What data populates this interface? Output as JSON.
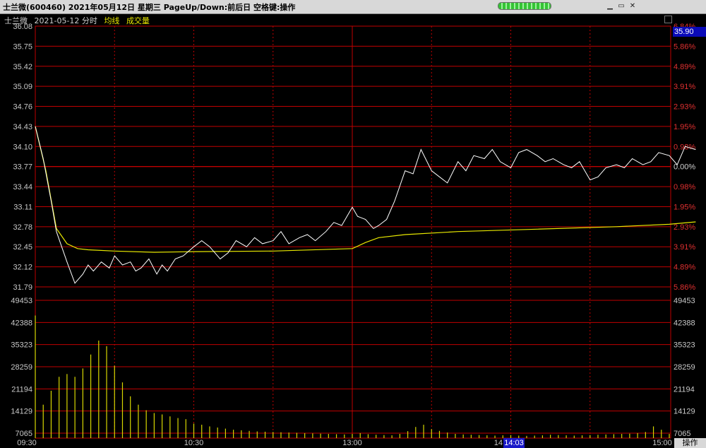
{
  "window": {
    "title": "士兰微(600460)  2021年05月12日 星期三  PageUp/Down:前后日  空格键:操作"
  },
  "header": {
    "name": "士兰微",
    "date": "2021-05-12 分时",
    "legend_avg": "均线",
    "legend_vol": "成交量"
  },
  "price_box": "35.90",
  "corner_button": "操作",
  "cursor_time": "14:03",
  "colors": {
    "grid": "#c00000",
    "price_line": "#ffffff",
    "avg_line": "#e8e800",
    "volume": "#d8d800",
    "axis_text_left": "#c8c8c8",
    "axis_text_right": "#e03030"
  },
  "chart_data": {
    "type": "line",
    "price_ticks": [
      "36.08",
      "35.75",
      "35.42",
      "35.09",
      "34.76",
      "34.43",
      "34.10",
      "33.77",
      "33.44",
      "33.11",
      "32.78",
      "32.45",
      "32.12",
      "31.79"
    ],
    "pct_ticks": [
      "6.84%",
      "5.86%",
      "4.89%",
      "3.91%",
      "2.93%",
      "1.95%",
      "0.98%",
      "0.00%",
      "0.98%",
      "1.95%",
      "2.93%",
      "3.91%",
      "4.89%",
      "5.86%"
    ],
    "ylim_price": [
      31.79,
      36.08
    ],
    "volume_ticks": [
      "49453",
      "42388",
      "35323",
      "28259",
      "21194",
      "14129",
      "7065"
    ],
    "ylim_volume": [
      0,
      49453
    ],
    "x_ticks": [
      "09:30",
      "10:30",
      "13:00",
      "14",
      "15:00"
    ],
    "price_series": {
      "minutes": [
        0,
        3,
        6,
        8,
        12,
        15,
        18,
        20,
        22,
        25,
        28,
        30,
        33,
        36,
        38,
        40,
        43,
        46,
        48,
        50,
        53,
        56,
        60,
        63,
        66,
        70,
        73,
        76,
        80,
        83,
        86,
        90,
        93,
        96,
        100,
        103,
        106,
        110,
        113,
        116,
        120,
        122,
        125,
        128,
        130,
        133,
        136,
        140,
        143,
        146,
        150,
        153,
        156,
        160,
        163,
        166,
        170,
        173,
        176,
        180,
        183,
        186,
        190,
        193,
        196,
        200,
        203,
        206,
        210,
        213,
        216,
        220,
        223,
        226,
        230,
        233,
        236,
        240,
        243,
        246,
        250
      ],
      "prices": [
        34.43,
        33.9,
        33.2,
        32.7,
        32.2,
        31.85,
        32.0,
        32.15,
        32.05,
        32.2,
        32.1,
        32.3,
        32.15,
        32.2,
        32.05,
        32.1,
        32.25,
        32.0,
        32.15,
        32.05,
        32.25,
        32.3,
        32.45,
        32.55,
        32.45,
        32.25,
        32.35,
        32.55,
        32.45,
        32.6,
        32.5,
        32.55,
        32.7,
        32.5,
        32.6,
        32.65,
        32.55,
        32.7,
        32.85,
        32.8,
        33.1,
        32.95,
        32.9,
        32.75,
        32.8,
        32.9,
        33.2,
        33.7,
        33.65,
        34.05,
        33.7,
        33.6,
        33.5,
        33.85,
        33.7,
        33.95,
        33.9,
        34.05,
        33.85,
        33.75,
        34.0,
        34.05,
        33.95,
        33.85,
        33.9,
        33.8,
        33.75,
        33.85,
        33.55,
        33.6,
        33.75,
        33.8,
        33.75,
        33.9,
        33.8,
        33.85,
        34.0,
        33.95,
        33.8,
        34.1,
        34.05
      ]
    },
    "avg_series": {
      "minutes": [
        0,
        4,
        8,
        12,
        16,
        20,
        30,
        45,
        60,
        90,
        120,
        122,
        125,
        130,
        140,
        160,
        190,
        220,
        240,
        250
      ],
      "prices": [
        34.43,
        33.7,
        32.75,
        32.5,
        32.42,
        32.4,
        32.38,
        32.36,
        32.37,
        32.38,
        32.42,
        32.46,
        32.52,
        32.6,
        32.65,
        32.7,
        32.74,
        32.78,
        32.82,
        32.86
      ]
    },
    "volume_values": [
      44000,
      12000,
      17000,
      22000,
      23000,
      22000,
      25000,
      30000,
      35000,
      33000,
      26000,
      20000,
      15000,
      12000,
      10000,
      9000,
      8500,
      7800,
      7200,
      6800,
      5200,
      4800,
      4200,
      3800,
      3400,
      3000,
      2800,
      2600,
      2400,
      2300,
      2200,
      2100,
      2000,
      1900,
      1800,
      1700,
      1600,
      1500,
      1400,
      1300,
      1500,
      1800,
      1400,
      1200,
      1100,
      1000,
      1500,
      2500,
      4000,
      4800,
      3200,
      2600,
      2000,
      1500,
      1300,
      1200,
      1100,
      1000,
      900,
      1000,
      1100,
      900,
      800,
      900,
      1000,
      1200,
      1100,
      1000,
      900,
      1000,
      1100,
      1200,
      1300,
      1400,
      1500,
      1600,
      1800,
      2200,
      4200,
      3000,
      1500
    ],
    "volume_note_hidden": ""
  }
}
